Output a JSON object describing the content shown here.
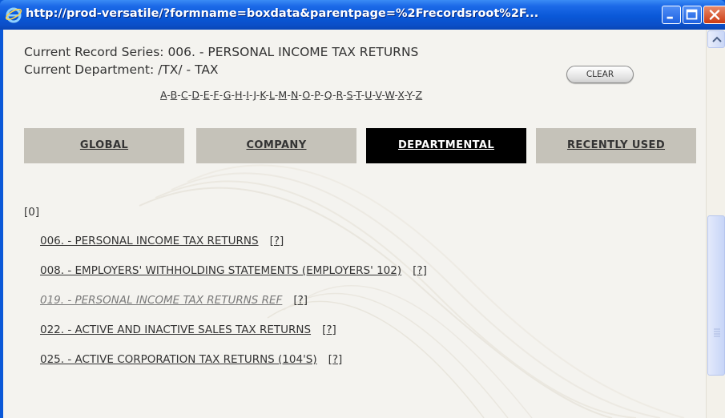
{
  "window": {
    "title": "http://prod-versatile/?formname=boxdata&parentpage=%2Frecordsroot%2F..."
  },
  "header": {
    "series_label": "Current Record Series: 006. - PERSONAL INCOME TAX RETURNS",
    "department_label": "Current Department: /TX/ - TAX",
    "clear_button": "CLEAR"
  },
  "alphabet": [
    "A",
    "B",
    "C",
    "D",
    "E",
    "F",
    "G",
    "H",
    "I",
    "J",
    "K",
    "L",
    "M",
    "N",
    "O",
    "P",
    "Q",
    "R",
    "S",
    "T",
    "U",
    "V",
    "W",
    "X",
    "Y",
    "Z"
  ],
  "tabs": [
    {
      "label": "GLOBAL",
      "active": false
    },
    {
      "label": "COMPANY",
      "active": false
    },
    {
      "label": "DEPARTMENTAL",
      "active": true
    },
    {
      "label": "RECENTLY USED",
      "active": false
    }
  ],
  "group": {
    "label": "[0]"
  },
  "records": [
    {
      "label": "006. - PERSONAL INCOME TAX RETURNS",
      "help": "[?]",
      "inactive": false
    },
    {
      "label": "008. - EMPLOYERS' WITHHOLDING STATEMENTS (EMPLOYERS' 102)",
      "help": "[?]",
      "inactive": false
    },
    {
      "label": "019. - PERSONAL INCOME TAX RETURNS REF",
      "help": "[?]",
      "inactive": true
    },
    {
      "label": "022. - ACTIVE AND INACTIVE SALES TAX RETURNS",
      "help": "[?]",
      "inactive": false
    },
    {
      "label": "025. - ACTIVE CORPORATION TAX RETURNS (104'S)",
      "help": "[?]",
      "inactive": false
    }
  ],
  "colors": {
    "titlebar": "#0a58d8",
    "tab_inactive": "#c5c2b9",
    "tab_active": "#000000",
    "text": "#333333"
  }
}
